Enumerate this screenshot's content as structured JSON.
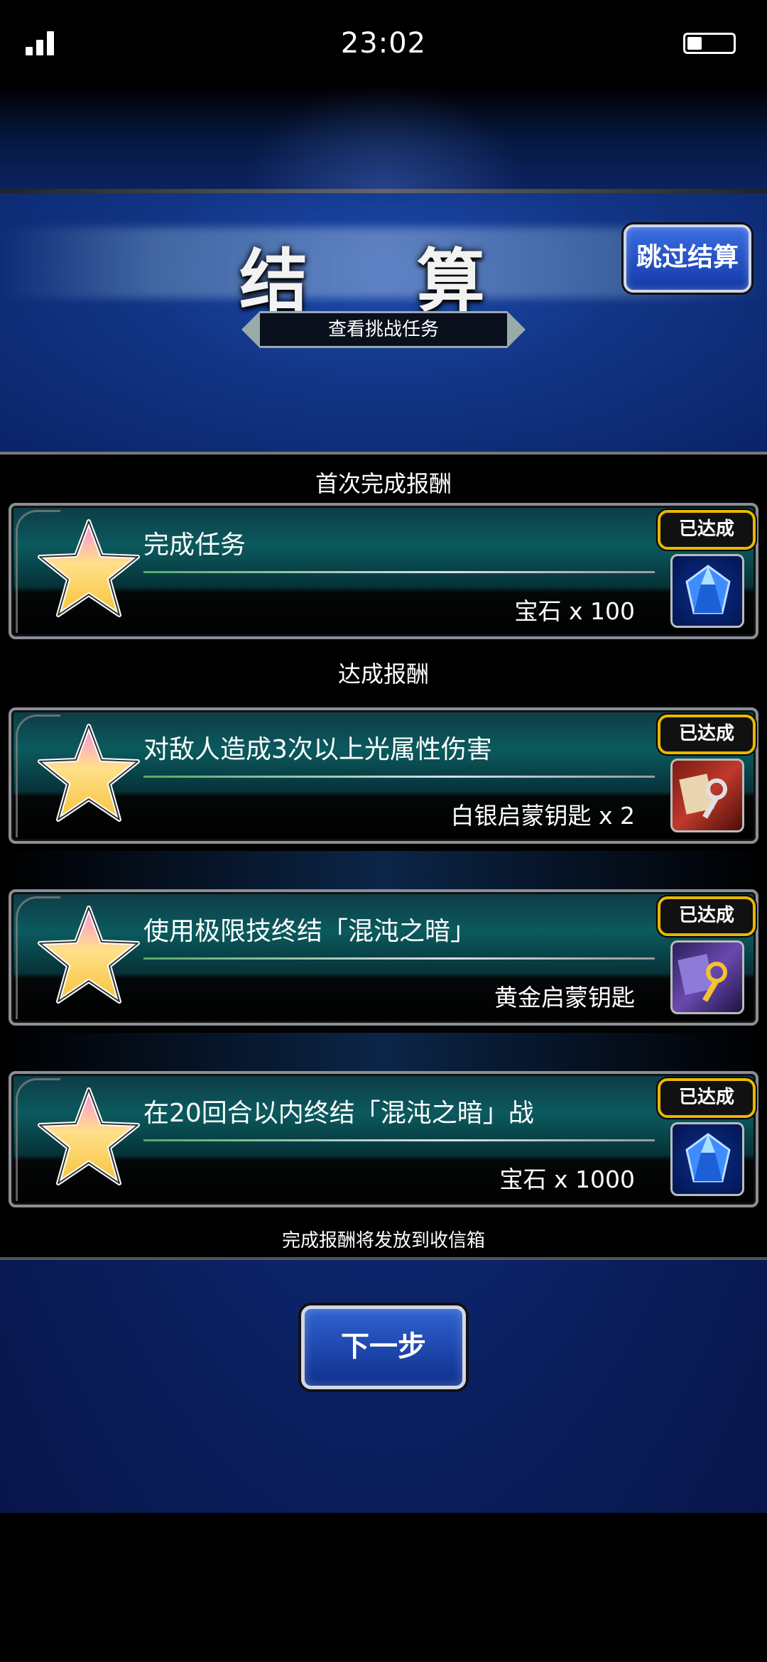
{
  "status_bar": {
    "time": "23:02"
  },
  "header": {
    "title": "结 算",
    "skip_button": "跳过结算",
    "task_tab": "查看挑战任务"
  },
  "sections": {
    "first_clear": "首次完成报酬",
    "achievement": "达成报酬"
  },
  "cards": [
    {
      "task": "完成任务",
      "reward": "宝石 x 100",
      "badge": "已达成",
      "item_icon": "gem-icon"
    },
    {
      "task": "对敌人造成3次以上光属性伤害",
      "reward": "白银启蒙钥匙 x 2",
      "badge": "已达成",
      "item_icon": "silver-key-icon"
    },
    {
      "task": "使用极限技终结「混沌之暗」",
      "reward": "黄金启蒙钥匙",
      "badge": "已达成",
      "item_icon": "gold-key-icon"
    },
    {
      "task": "在20回合以内终结「混沌之暗」战",
      "reward": "宝石 x 1000",
      "badge": "已达成",
      "item_icon": "gem-icon"
    }
  ],
  "footer_note": "完成报酬将发放到收信箱",
  "next_button": "下一步",
  "colors": {
    "badge_border": "#e8b800",
    "button_blue": "#1438a8",
    "card_teal": "#0b5a5e"
  }
}
